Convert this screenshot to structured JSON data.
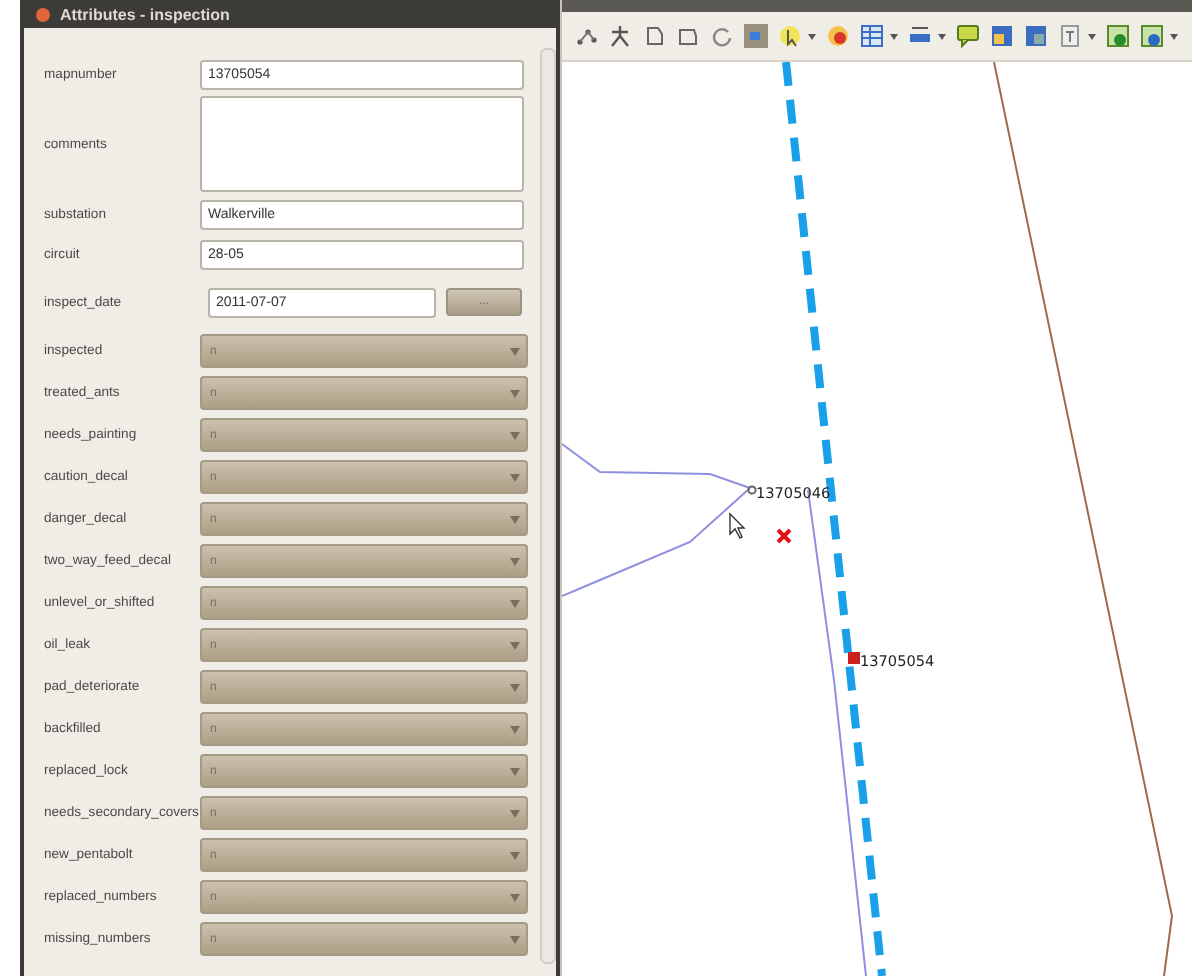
{
  "dialog": {
    "title": "Attributes - inspection",
    "fields": [
      {
        "label": "mapnumber",
        "kind": "text",
        "value": "13705054"
      },
      {
        "label": "comments",
        "kind": "textarea"
      },
      {
        "label": "substation",
        "kind": "text",
        "value": "Walkerville"
      },
      {
        "label": "circuit",
        "kind": "text",
        "value": "28-05"
      },
      {
        "label": "inspect_date",
        "kind": "date",
        "value": "2011-07-07",
        "button": "..."
      },
      {
        "label": "inspected",
        "kind": "combo",
        "value": "n"
      },
      {
        "label": "treated_ants",
        "kind": "combo",
        "value": "n"
      },
      {
        "label": "needs_painting",
        "kind": "combo",
        "value": "n"
      },
      {
        "label": "caution_decal",
        "kind": "combo",
        "value": "n"
      },
      {
        "label": "danger_decal",
        "kind": "combo",
        "value": "n"
      },
      {
        "label": "two_way_feed_decal",
        "kind": "combo",
        "value": "n"
      },
      {
        "label": "unlevel_or_shifted",
        "kind": "combo",
        "value": "n"
      },
      {
        "label": "oil_leak",
        "kind": "combo",
        "value": "n"
      },
      {
        "label": "pad_deteriorate",
        "kind": "combo",
        "value": "n"
      },
      {
        "label": "backfilled",
        "kind": "combo",
        "value": "n"
      },
      {
        "label": "replaced_lock",
        "kind": "combo",
        "value": "n"
      },
      {
        "label": "needs_secondary_covers",
        "kind": "combo",
        "value": "n"
      },
      {
        "label": "new_pentabolt",
        "kind": "combo",
        "value": "n"
      },
      {
        "label": "replaced_numbers",
        "kind": "combo",
        "value": "n"
      },
      {
        "label": "missing_numbers",
        "kind": "combo",
        "value": "n"
      }
    ]
  },
  "map": {
    "features": [
      {
        "label": "13705046",
        "selected": false
      },
      {
        "label": "13705054",
        "selected": true
      }
    ]
  }
}
